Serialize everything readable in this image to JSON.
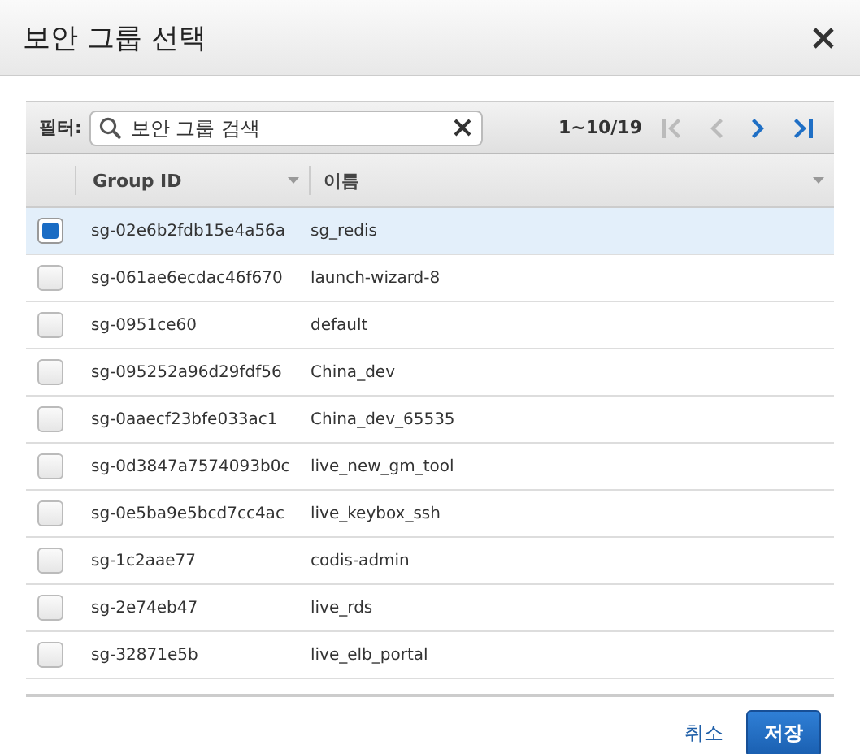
{
  "window": {
    "title": "보안 그룹 선택"
  },
  "filter": {
    "label": "필터:",
    "placeholder": "보안 그룹 검색"
  },
  "pagination": {
    "range": "1~10/19",
    "buttons": [
      {
        "kind": "first",
        "disabled": true
      },
      {
        "kind": "prev",
        "disabled": true
      },
      {
        "kind": "next",
        "disabled": false
      },
      {
        "kind": "last",
        "disabled": false
      }
    ]
  },
  "table": {
    "columns": [
      "Group ID",
      "이름"
    ],
    "rows": [
      {
        "id": "sg-02e6b2fdb15e4a56a",
        "name": "sg_redis",
        "selected": true
      },
      {
        "id": "sg-061ae6ecdac46f670",
        "name": "launch-wizard-8",
        "selected": false
      },
      {
        "id": "sg-0951ce60",
        "name": "default",
        "selected": false
      },
      {
        "id": "sg-095252a96d29fdf56",
        "name": "China_dev",
        "selected": false
      },
      {
        "id": "sg-0aaecf23bfe033ac1",
        "name": "China_dev_65535",
        "selected": false
      },
      {
        "id": "sg-0d3847a7574093b0c",
        "name": "live_new_gm_tool",
        "selected": false
      },
      {
        "id": "sg-0e5ba9e5bcd7cc4ac",
        "name": "live_keybox_ssh",
        "selected": false
      },
      {
        "id": "sg-1c2aae77",
        "name": "codis-admin",
        "selected": false
      },
      {
        "id": "sg-2e74eb47",
        "name": "live_rds",
        "selected": false
      },
      {
        "id": "sg-32871e5b",
        "name": "live_elb_portal",
        "selected": false
      }
    ]
  },
  "buttons": {
    "cancel": "취소",
    "save": "저장"
  }
}
